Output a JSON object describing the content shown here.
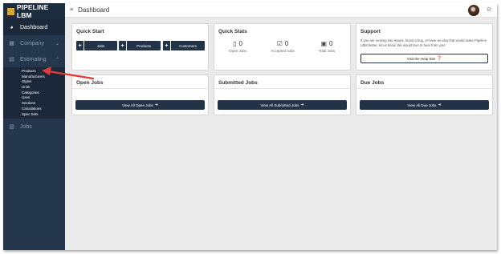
{
  "brand": {
    "name": "PIPELINE LBM"
  },
  "sidebar": {
    "items": [
      {
        "label": "Dashboard",
        "icon": "dashboard-icon"
      },
      {
        "label": "Company",
        "icon": "building-icon"
      },
      {
        "label": "Estimating",
        "icon": "calculator-icon"
      },
      {
        "label": "Jobs",
        "icon": "jobs-icon"
      }
    ],
    "submenu": [
      "Products",
      "Manufacturers",
      "Styles",
      "Units",
      "Categories",
      "Uses",
      "Sections",
      "Calculations",
      "Spec Sets"
    ]
  },
  "topbar": {
    "title": "Dashboard"
  },
  "quick_start": {
    "title": "Quick Start",
    "buttons": [
      {
        "plus": "+",
        "label": "Jobs"
      },
      {
        "plus": "+",
        "label": "Products"
      },
      {
        "plus": "+",
        "label": "Customers"
      }
    ]
  },
  "quick_stats": {
    "title": "Quick Stats",
    "stats": [
      {
        "value": "0",
        "label": "Open Jobs",
        "icon": "document-icon"
      },
      {
        "value": "0",
        "label": "Accepted Jobs",
        "icon": "check-box-icon"
      },
      {
        "value": "0",
        "label": "Total Jobs",
        "icon": "briefcase-icon"
      }
    ]
  },
  "support": {
    "title": "Support",
    "text": "If you are running into issues, found a bug, or have an idea that would make Pipeline LBM better, let us know. We would love to hear from you!",
    "button": "Visit the Help Site"
  },
  "panels": [
    {
      "title": "Open Jobs",
      "button": "View All Open Jobs"
    },
    {
      "title": "Submitted Jobs",
      "button": "View All Submitted Jobs"
    },
    {
      "title": "Due Jobs",
      "button": "View All Due Jobs"
    }
  ],
  "colors": {
    "sidebar": "#25374d",
    "button": "#223247",
    "annotation": "#e03a3a"
  }
}
